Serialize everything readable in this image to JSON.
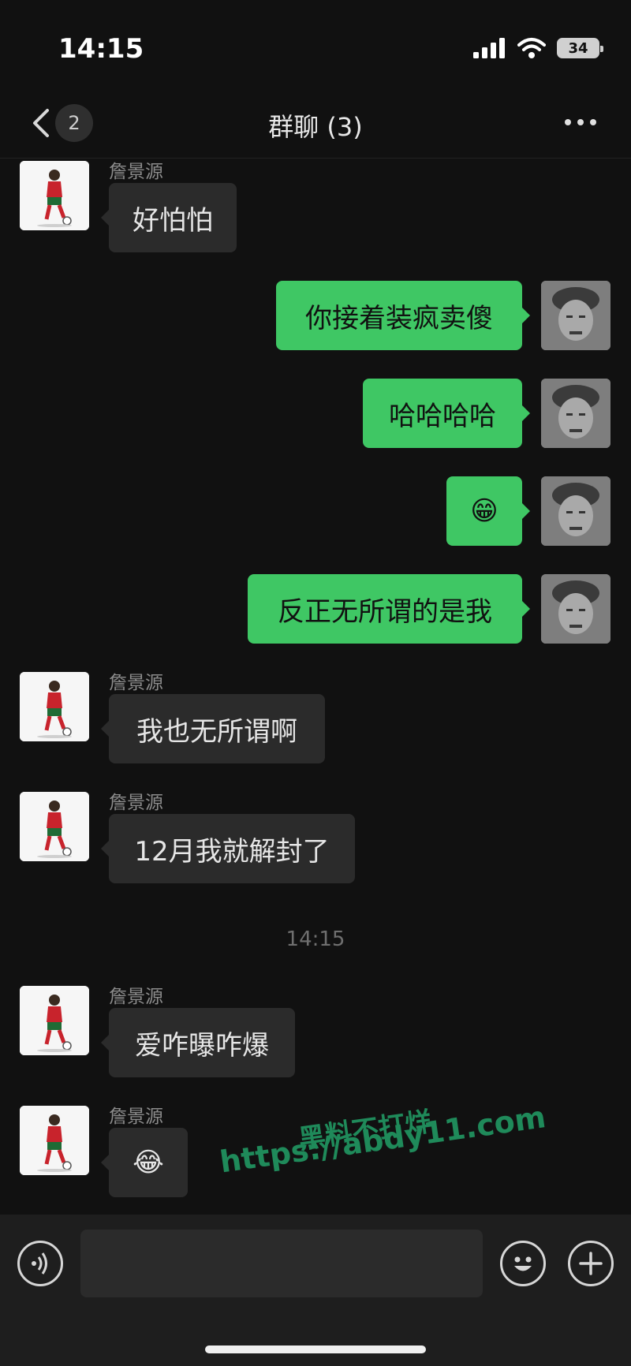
{
  "status_bar": {
    "time": "14:15",
    "battery": "34"
  },
  "nav": {
    "back_count": "2",
    "title": "群聊 (3)"
  },
  "messages": [
    {
      "side": "in",
      "sender": "詹景源",
      "text": "好怕怕"
    },
    {
      "side": "out",
      "text": "你接着装疯卖傻"
    },
    {
      "side": "out",
      "text": "哈哈哈哈"
    },
    {
      "side": "out",
      "text": "😁"
    },
    {
      "side": "out",
      "text": "反正无所谓的是我"
    },
    {
      "side": "in",
      "sender": "詹景源",
      "text": "我也无所谓啊"
    },
    {
      "side": "in",
      "sender": "詹景源",
      "text": "12月我就解封了"
    },
    {
      "side": "in",
      "sender": "詹景源",
      "text": "爱咋曝咋爆"
    },
    {
      "side": "in",
      "sender": "詹景源",
      "text": "😂"
    }
  ],
  "timestamp": "14:15",
  "watermark": {
    "line1": "黑料不打烊",
    "line2": "https://abdy11.com"
  },
  "input_bar": {
    "placeholder": ""
  },
  "icons": {
    "back": "chevron-left-icon",
    "more": "more-dots-icon",
    "voice": "voice-icon",
    "emoji": "emoji-icon",
    "plus": "plus-icon"
  },
  "colors": {
    "outgoing_bubble": "#3fc764",
    "incoming_bubble": "#2b2b2b",
    "background": "#111111"
  }
}
